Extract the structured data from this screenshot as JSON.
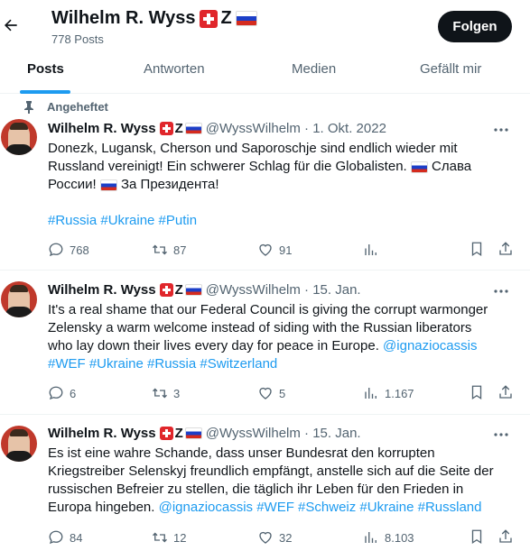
{
  "header": {
    "name": "Wilhelm R. Wyss",
    "z": "Z",
    "post_count": "778 Posts",
    "follow_label": "Folgen"
  },
  "tabs": [
    {
      "label": "Posts",
      "active": true
    },
    {
      "label": "Antworten",
      "active": false
    },
    {
      "label": "Medien",
      "active": false
    },
    {
      "label": "Gefällt mir",
      "active": false
    }
  ],
  "tweets": [
    {
      "pinned_label": "Angeheftet",
      "name": "Wilhelm R. Wyss",
      "z": "Z",
      "handle_date": "@WyssWilhelm · 1. Okt. 2022",
      "line1": "Donezk, Lugansk, Cherson und Saporoschje sind endlich wieder mit",
      "line2a": "Russland vereinigt! Ein schwerer Schlag für die Globalisten.",
      "line2b": "Слава",
      "line3a": "России!",
      "line3b": "За Президента!",
      "hashtags": "#Russia #Ukraine #Putin",
      "replies": "768",
      "reposts": "87",
      "likes": "91",
      "views": ""
    },
    {
      "name": "Wilhelm R. Wyss",
      "z": "Z",
      "handle_date": "@WyssWilhelm · 15. Jan.",
      "line1": "It's a real shame that our Federal Council is giving the corrupt warmonger",
      "line2": "Zelensky a warm welcome instead of siding with the Russian liberators",
      "line3a": "who lay down their lives every day for peace in Europe.",
      "line3b": "@ignaziocassis",
      "line4": "#WEF #Ukraine #Russia #Switzerland",
      "replies": "6",
      "reposts": "3",
      "likes": "5",
      "views": "1.167"
    },
    {
      "name": "Wilhelm R. Wyss",
      "z": "Z",
      "handle_date": "@WyssWilhelm · 15. Jan.",
      "line1": "Es ist eine wahre Schande, dass unser Bundesrat den korrupten",
      "line2": "Kriegstreiber Selenskyj freundlich empfängt, anstelle sich auf die Seite der",
      "line3": "russischen Befreier zu stellen, die täglich ihr Leben für den Frieden in",
      "line4a": "Europa hingeben.",
      "line4b": "@ignaziocassis #WEF #Schweiz #Ukraine #Russland",
      "replies": "84",
      "reposts": "12",
      "likes": "32",
      "views": "8.103"
    }
  ],
  "icons": {
    "back": "arrow-left-icon",
    "pin": "pin-icon",
    "more": "more-horizontal-icon",
    "reply": "reply-icon",
    "repost": "repost-icon",
    "like": "heart-icon",
    "views": "views-icon",
    "bookmark": "bookmark-icon",
    "share": "share-icon"
  },
  "colors": {
    "accent": "#1d9bf0",
    "text": "#0f1419",
    "muted": "#536471",
    "follow_bg": "#0f1419"
  }
}
